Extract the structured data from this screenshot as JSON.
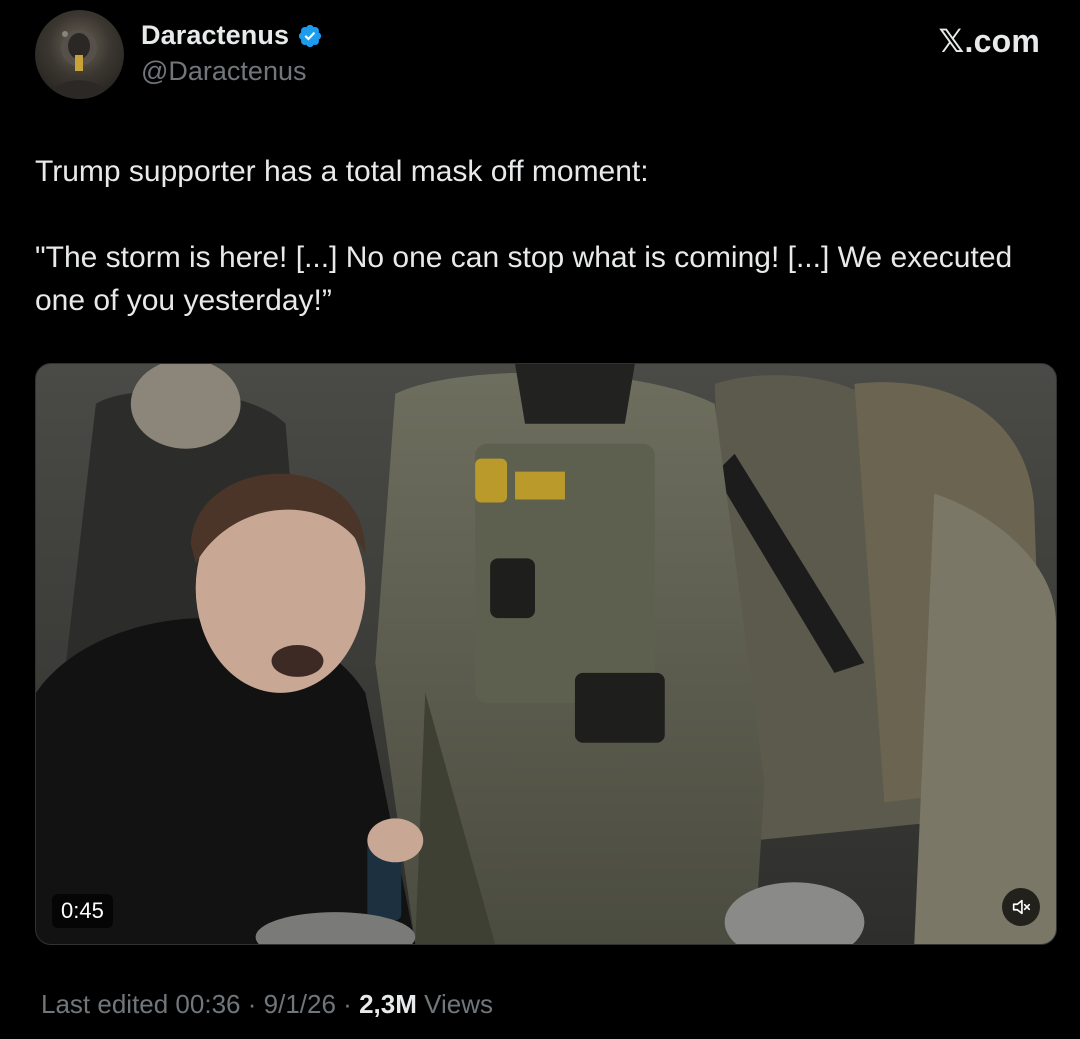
{
  "header": {
    "display_name": "Daractenus",
    "handle": "@Daractenus",
    "brand": "𝕏.com"
  },
  "tweet": {
    "paragraphs": [
      "Trump supporter has a total mask off moment:",
      "\"The storm is here! [...] No one can stop what is coming! [...] We executed one of you yesterday!”"
    ]
  },
  "media": {
    "duration": "0:45",
    "mute_icon": "volume-muted-icon"
  },
  "footer": {
    "edited_label": "Last edited 00:36",
    "separator": "·",
    "date": "9/1/26",
    "views_count": "2,3M",
    "views_label": "Views"
  },
  "colors": {
    "background": "#000000",
    "text_primary": "#e7e9ea",
    "text_secondary": "#71767b",
    "verified_blue": "#1d9bf0"
  }
}
